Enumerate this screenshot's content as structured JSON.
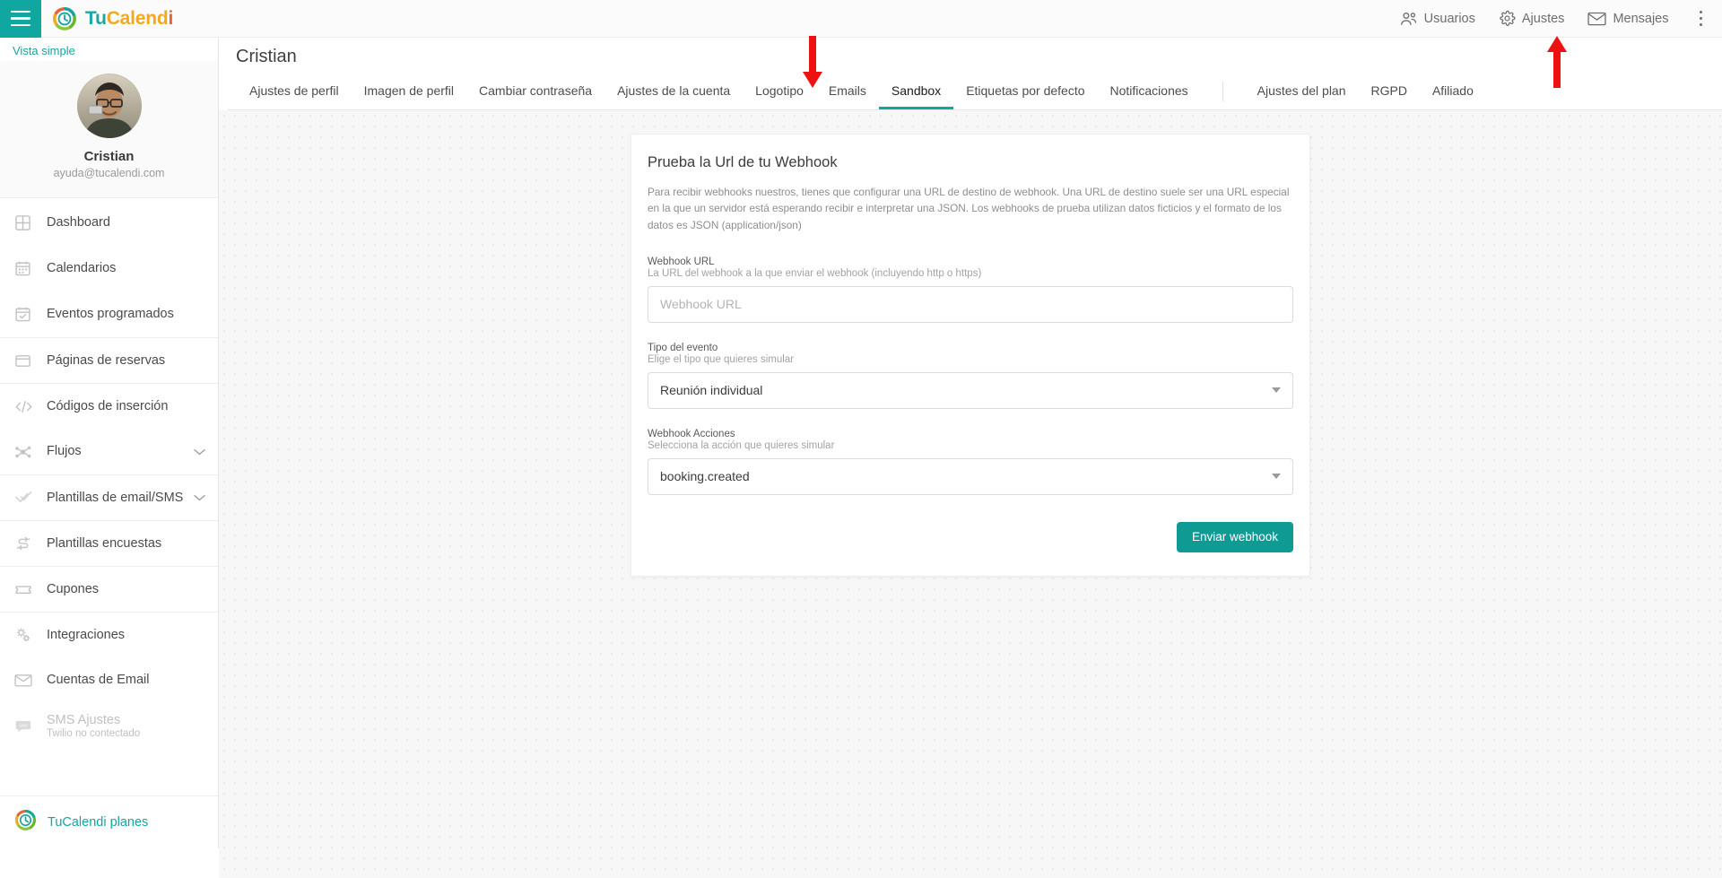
{
  "app": {
    "brand": {
      "part1": "Tu",
      "part2": "Calend",
      "part3": "i",
      "logo_icon": "tucalendi-logo-icon"
    },
    "menu_icon": "hamburger-menu-icon"
  },
  "topbar": {
    "items": [
      {
        "label": "Usuarios",
        "icon": "users-icon"
      },
      {
        "label": "Ajustes",
        "icon": "gear-icon"
      },
      {
        "label": "Mensajes",
        "icon": "envelope-icon"
      }
    ],
    "overflow_icon": "kebab-menu-icon"
  },
  "sidebar": {
    "view_toggle": "Vista simple",
    "profile": {
      "name": "Cristian",
      "email": "ayuda@tucalendi.com",
      "avatar": "user-avatar"
    },
    "items": [
      {
        "label": "Dashboard",
        "icon": "grid-icon",
        "separator": false,
        "expandable": false,
        "disabled": false
      },
      {
        "label": "Calendarios",
        "icon": "calendar-icon",
        "separator": false,
        "expandable": false,
        "disabled": false
      },
      {
        "label": "Eventos programados",
        "icon": "calendar-check-icon",
        "separator": false,
        "expandable": false,
        "disabled": false
      },
      {
        "label": "Páginas de reservas",
        "icon": "window-icon",
        "separator": true,
        "expandable": false,
        "disabled": false
      },
      {
        "label": "Códigos de inserción",
        "icon": "code-icon",
        "separator": true,
        "expandable": false,
        "disabled": false
      },
      {
        "label": "Flujos",
        "icon": "flow-icon",
        "separator": false,
        "expandable": true,
        "disabled": false
      },
      {
        "label": "Plantillas de email/SMS",
        "icon": "double-check-icon",
        "separator": true,
        "expandable": true,
        "disabled": false
      },
      {
        "label": "Plantillas encuestas",
        "icon": "survey-icon",
        "separator": true,
        "expandable": false,
        "disabled": false
      },
      {
        "label": "Cupones",
        "icon": "ticket-icon",
        "separator": true,
        "expandable": false,
        "disabled": false
      },
      {
        "label": "Integraciones",
        "icon": "gears-icon",
        "separator": true,
        "expandable": false,
        "disabled": false
      },
      {
        "label": "Cuentas de Email",
        "icon": "mail-icon",
        "separator": false,
        "expandable": false,
        "disabled": false
      },
      {
        "label": "SMS Ajustes",
        "sublabel": "Twilio no contectado",
        "icon": "sms-bubble-icon",
        "separator": false,
        "expandable": false,
        "disabled": true
      }
    ],
    "footer": {
      "label": "TuCalendi planes",
      "icon": "tucalendi-logo-icon"
    }
  },
  "page": {
    "title": "Cristian",
    "tabs": [
      {
        "label": "Ajustes de perfil",
        "active": false
      },
      {
        "label": "Imagen de perfil",
        "active": false
      },
      {
        "label": "Cambiar contraseña",
        "active": false
      },
      {
        "label": "Ajustes de la cuenta",
        "active": false
      },
      {
        "label": "Logotipo",
        "active": false
      },
      {
        "label": "Emails",
        "active": false
      },
      {
        "label": "Sandbox",
        "active": true
      },
      {
        "label": "Etiquetas por defecto",
        "active": false
      },
      {
        "label": "Notificaciones",
        "active": false
      },
      {
        "label": "Ajustes del plan",
        "active": false
      },
      {
        "label": "RGPD",
        "active": false
      },
      {
        "label": "Afiliado",
        "active": false
      }
    ],
    "tab_divider_after_index": 8
  },
  "card": {
    "title": "Prueba la Url de tu Webhook",
    "description": "Para recibir webhooks nuestros, tienes que configurar una URL de destino de webhook. Una URL de destino suele ser una URL especial en la que un servidor está esperando recibir e interpretar una JSON. Los webhooks de prueba utilizan datos ficticios y el formato de los datos es JSON (application/json)",
    "fields": {
      "webhook_url": {
        "label": "Webhook URL",
        "hint": "La URL del webhook a la que enviar el webhook (incluyendo http o https)",
        "placeholder": "Webhook URL",
        "value": ""
      },
      "event_type": {
        "label": "Tipo del evento",
        "hint": "Elige el tipo que quieres simular",
        "value": "Reunión individual"
      },
      "webhook_actions": {
        "label": "Webhook Acciones",
        "hint": "Selecciona la acción que quieres simular",
        "value": "booking.created"
      }
    },
    "submit_label": "Enviar webhook"
  },
  "annotations": {
    "color": "#ee1111",
    "markers": [
      {
        "name": "arrow-pointing-to-sandbox-tab",
        "direction": "down"
      },
      {
        "name": "arrow-pointing-to-ajustes-menu",
        "direction": "up"
      }
    ]
  },
  "colors": {
    "brand_teal": "#10a7a0",
    "brand_orange": "#f2a922",
    "brand_red": "#e8603c",
    "accent": "#109a94",
    "annotation_red": "#ee1111"
  }
}
